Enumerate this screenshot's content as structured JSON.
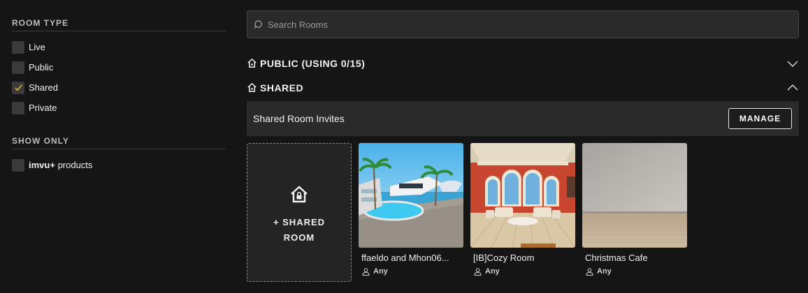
{
  "sidebar": {
    "room_type_title": "ROOM TYPE",
    "room_types": [
      {
        "label": "Live",
        "checked": false
      },
      {
        "label": "Public",
        "checked": false
      },
      {
        "label": "Shared",
        "checked": true
      },
      {
        "label": "Private",
        "checked": false
      }
    ],
    "show_only_title": "SHOW ONLY",
    "show_only": {
      "bold_label": "imvu+",
      "label": "products",
      "checked": false
    }
  },
  "search": {
    "placeholder": "Search Rooms"
  },
  "groups": {
    "public": {
      "title": "PUBLIC (USING 0/15)",
      "expanded": false,
      "icon": "home-icon"
    },
    "shared": {
      "title": "SHARED",
      "expanded": true,
      "icon": "home-icon"
    }
  },
  "invites": {
    "title": "Shared Room Invites",
    "manage_label": "MANAGE"
  },
  "add_room": {
    "label": "+ SHARED ROOM",
    "icon": "home-lock-icon"
  },
  "rooms": [
    {
      "name": "ffaeldo and Mhon06...",
      "access": "Any"
    },
    {
      "name": "[IB]Cozy Room",
      "access": "Any"
    },
    {
      "name": "Christmas Cafe",
      "access": "Any"
    }
  ],
  "colors": {
    "checkmark": "#f0c040",
    "background": "#151515",
    "panel": "#2a2a2a"
  }
}
